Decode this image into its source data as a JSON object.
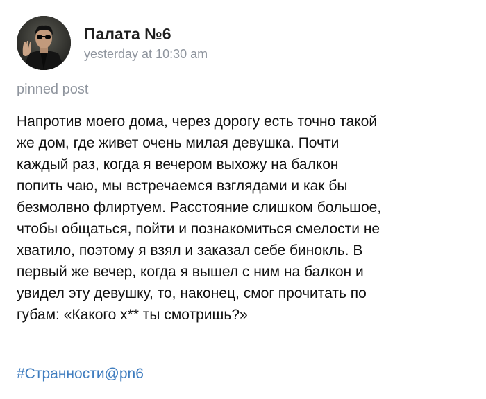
{
  "post": {
    "author": "Палата №6",
    "timestamp": "yesterday at 10:30 am",
    "pinned_label": "pinned post",
    "text_lines": [
      "Напротив моего дома, через дорогу есть точно такой",
      "же дом, где живет очень милая девушка. Почти",
      "каждый раз, когда я вечером выхожу на балкон",
      "попить чаю, мы встречаемся взглядами и как бы",
      "безмолвно флиртуем. Расстояние слишком большое,",
      "чтобы общаться, пойти и познакомиться смелости не",
      "хватило, поэтому я взял и заказал себе бинокль. В",
      "первый же вечер, когда я вышел с ним на балкон и",
      "увидел эту девушку, то, наконец, смог прочитать по",
      "губам: «Какого х** ты смотришь?»"
    ],
    "hashtag": "#Странности@pn6"
  },
  "colors": {
    "secondary_text": "#8f959e",
    "link": "#3f7dbf",
    "main_text": "#111111"
  }
}
